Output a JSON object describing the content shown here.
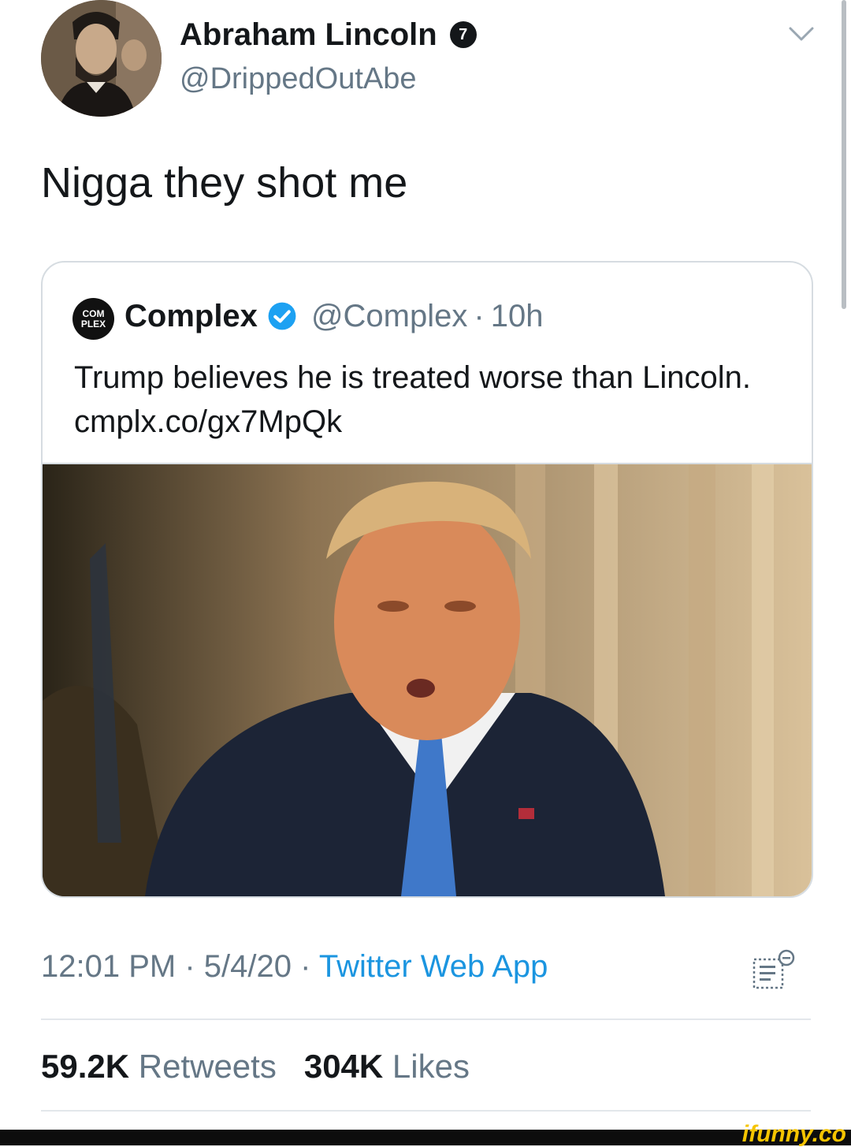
{
  "author": {
    "name": "Abraham Lincoln",
    "badge": "7",
    "handle": "@DrippedOutAbe"
  },
  "tweet": {
    "text": "Nigga they shot me"
  },
  "quote": {
    "avatar_text": "COM PLEX",
    "name": "Complex",
    "handle": "@Complex",
    "separator": "·",
    "time": "10h",
    "text": "Trump believes he is treated worse than Lincoln. cmplx.co/gx7MpQk"
  },
  "meta": {
    "time": "12:01 PM",
    "sep1": "·",
    "date": "5/4/20",
    "sep2": "·",
    "source": "Twitter Web App"
  },
  "stats": {
    "retweets_count": "59.2K",
    "retweets_label": "Retweets",
    "likes_count": "304K",
    "likes_label": "Likes"
  },
  "watermark": "ifunny.co",
  "colors": {
    "link": "#1b95e0",
    "secondary": "#657786",
    "verified": "#1da1f2",
    "border": "#d6dce1"
  },
  "icons": [
    "chevron-down-icon",
    "verified-icon",
    "analytics-icon"
  ]
}
